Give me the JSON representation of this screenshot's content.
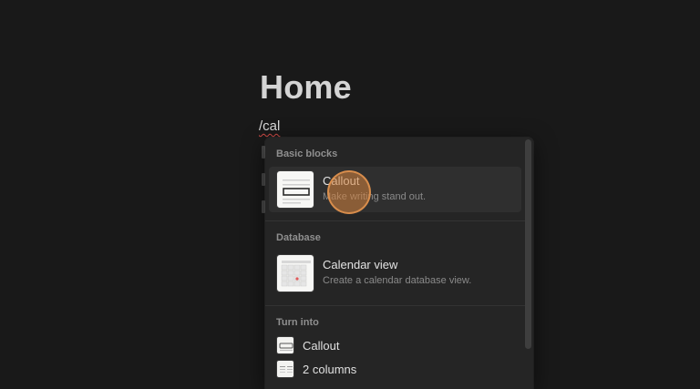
{
  "page": {
    "title": "Home",
    "typed_command": "/cal"
  },
  "menu": {
    "sections": {
      "basic_blocks": {
        "label": "Basic blocks",
        "items": [
          {
            "title": "Callout",
            "description": "Make writing stand out.",
            "icon": "callout-icon"
          }
        ]
      },
      "database": {
        "label": "Database",
        "items": [
          {
            "title": "Calendar view",
            "description": "Create a calendar database view.",
            "icon": "calendar-icon"
          }
        ]
      },
      "turn_into": {
        "label": "Turn into",
        "items": [
          {
            "title": "Callout",
            "icon": "callout-icon"
          },
          {
            "title": "2 columns",
            "icon": "columns-icon"
          }
        ]
      }
    }
  },
  "colors": {
    "background": "#191919",
    "menu_background": "#252525",
    "selected_item": "#2f2f2f",
    "cursor_highlight": "#d6843e",
    "spellcheck_underline": "#d44c47"
  }
}
